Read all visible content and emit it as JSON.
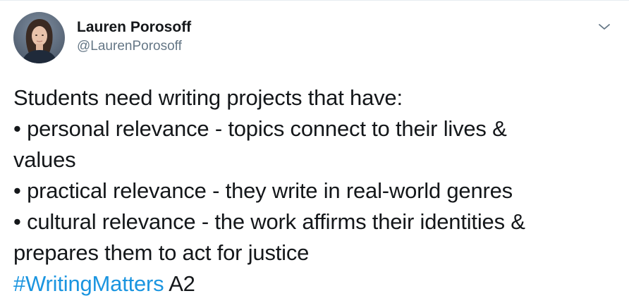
{
  "author": {
    "display_name": "Lauren Porosoff",
    "handle": "@LaurenPorosoff"
  },
  "tweet": {
    "line1": "Students need writing projects that have:",
    "line2": "• personal relevance - topics connect to their lives &",
    "line3": "values",
    "line4": "• practical relevance - they write in real-world genres",
    "line5": "• cultural relevance - the work affirms their identities &",
    "line6": "prepares them to act for justice",
    "hashtag": "#WritingMatters",
    "suffix": "A2"
  },
  "icons": {
    "menu": "chevron-down-icon",
    "avatar": "profile-photo"
  },
  "colors": {
    "hashtag": "#1b95e0",
    "text": "#14171a",
    "handle": "#657786",
    "chevron": "#657786"
  }
}
